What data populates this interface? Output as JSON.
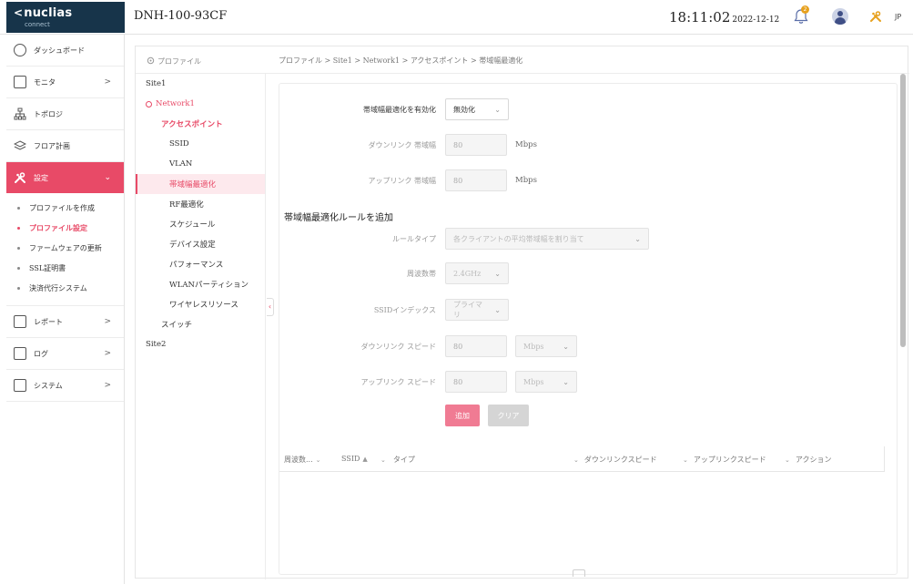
{
  "brand": {
    "name": "nuclias",
    "sub": "connect",
    "chevron": "<"
  },
  "header": {
    "device_name": "DNH-100-93CF",
    "time": "18:11:02",
    "date": "2022-12-12",
    "notification_count": "2",
    "language": "JP"
  },
  "nav": {
    "items": [
      {
        "label": "ダッシュボード",
        "icon": "dashboard-icon"
      },
      {
        "label": "モニタ",
        "icon": "monitor-icon",
        "arrow": ">"
      },
      {
        "label": "トポロジ",
        "icon": "topology-icon"
      },
      {
        "label": "フロア計画",
        "icon": "floor-plan-icon"
      },
      {
        "label": "設定",
        "icon": "settings-tools-icon",
        "arrow": "⌄"
      },
      {
        "label": "レポート",
        "icon": "report-icon",
        "arrow": ">"
      },
      {
        "label": "ログ",
        "icon": "log-icon",
        "arrow": ">"
      },
      {
        "label": "システム",
        "icon": "system-icon",
        "arrow": ">"
      }
    ],
    "settings_sub": [
      "プロファイルを作成",
      "プロファイル設定",
      "ファームウェアの更新",
      "SSL証明書",
      "決済代行システム"
    ]
  },
  "tree": {
    "header": "プロファイル",
    "site1": "Site1",
    "network1": "Network1",
    "access_point": "アクセスポイント",
    "ap_items": [
      "SSID",
      "VLAN",
      "帯域幅最適化",
      "RF最適化",
      "スケジュール",
      "デバイス設定",
      "パフォーマンス",
      "WLANパーティション",
      "ワイヤレスリソース"
    ],
    "switch": "スイッチ",
    "site2": "Site2"
  },
  "breadcrumb": "プロファイル > Site1 > Network1 > アクセスポイント > 帯域幅最適化",
  "form": {
    "enable_label": "帯域幅最適化を有効化",
    "enable_value": "無効化",
    "downlink_label": "ダウンリンク 帯域幅",
    "downlink_value": "80",
    "downlink_unit": "Mbps",
    "uplink_label": "アップリンク 帯域幅",
    "uplink_value": "80",
    "uplink_unit": "Mbps",
    "section_title": "帯域幅最適化ルールを追加",
    "rule_type_label": "ルールタイプ",
    "rule_type_value": "各クライアントの平均帯域幅を割り当て",
    "band_label": "周波数帯",
    "band_value": "2.4GHz",
    "ssid_index_label": "SSIDインデックス",
    "ssid_index_value": "プライマリ",
    "down_speed_label": "ダウンリンク スピード",
    "down_speed_value": "80",
    "down_speed_unit": "Mbps",
    "up_speed_label": "アップリンク スピード",
    "up_speed_value": "80",
    "up_speed_unit": "Mbps",
    "add_button": "追加",
    "clear_button": "クリア"
  },
  "table": {
    "columns": [
      "周波数...",
      "SSID",
      "タイプ",
      "ダウンリンクスピード",
      "アップリンクスピード",
      "アクション"
    ]
  }
}
